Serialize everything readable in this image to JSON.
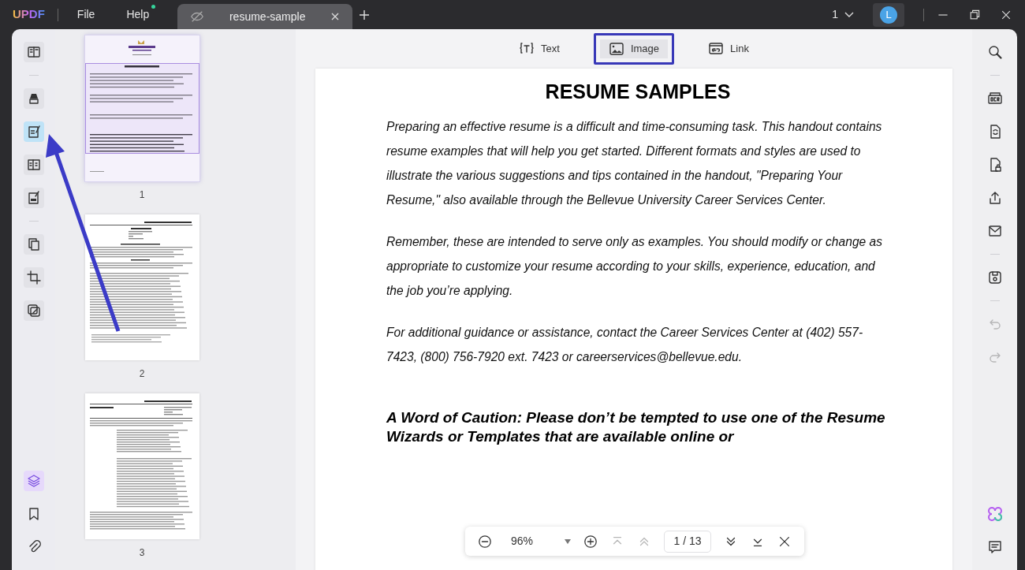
{
  "app": {
    "logo": "UPDF",
    "menus": [
      {
        "label": "File",
        "dot": false
      },
      {
        "label": "Help",
        "dot": true
      }
    ]
  },
  "tabs": [
    {
      "label": "resume-sample",
      "selected": true
    }
  ],
  "page_selector": "1",
  "avatar": "L",
  "left_tools": [
    {
      "kind": "reader",
      "selected": false
    },
    {
      "kind": "divider"
    },
    {
      "kind": "highlighter",
      "selected": false
    },
    {
      "kind": "edit",
      "selected": true
    },
    {
      "kind": "form",
      "selected": false
    },
    {
      "kind": "sign",
      "selected": false
    },
    {
      "kind": "divider"
    },
    {
      "kind": "pages",
      "selected": false
    },
    {
      "kind": "crop",
      "selected": false
    },
    {
      "kind": "watermark",
      "selected": false
    }
  ],
  "left_bottom_tools": [
    {
      "kind": "layers",
      "selected": true
    },
    {
      "kind": "bookmark",
      "selected": false
    },
    {
      "kind": "attachment",
      "selected": false
    }
  ],
  "thumbnails": [
    {
      "number": "1",
      "selected": true,
      "kind": "cover"
    },
    {
      "number": "2",
      "selected": false,
      "kind": "functional"
    },
    {
      "number": "3",
      "selected": false,
      "kind": "chronological"
    }
  ],
  "edit_toolbar": [
    {
      "label": "Text",
      "kind": "text",
      "selected": false
    },
    {
      "label": "Image",
      "kind": "image",
      "selected": true
    },
    {
      "label": "Link",
      "kind": "link",
      "selected": false
    }
  ],
  "document": {
    "heading": "RESUME SAMPLES",
    "paragraphs": [
      "Preparing an effective resume is a difficult and time-consuming task.  This handout contains resume examples that will help you get started.  Different formats and styles are used to illustrate the various suggestions and tips contained in the handout, \"Preparing Your Resume,\" also available through the Bellevue University Career Services Center.",
      "Remember, these are intended to serve only as examples.  You should modify or change as appropriate to customize your resume according to your skills, experience, education, and the job you’re applying.",
      "For additional guidance or assistance, contact the Career Services Center at (402) 557-7423, (800) 756-7920 ext. 7423 or careerservices@bellevue.edu."
    ],
    "caution": "A Word of Caution: Please don’t be tempted to use one of the Resume Wizards or Templates that are available online or"
  },
  "right_tools": [
    {
      "kind": "search",
      "disabled": false
    },
    {
      "kind": "divider"
    },
    {
      "kind": "ocr",
      "disabled": false
    },
    {
      "kind": "convert",
      "disabled": false
    },
    {
      "kind": "protect",
      "disabled": false
    },
    {
      "kind": "share",
      "disabled": false
    },
    {
      "kind": "mail",
      "disabled": false
    },
    {
      "kind": "divider"
    },
    {
      "kind": "save",
      "disabled": false
    },
    {
      "kind": "divider"
    },
    {
      "kind": "undo",
      "disabled": true
    },
    {
      "kind": "redo",
      "disabled": true
    }
  ],
  "right_bottom_tools": [
    {
      "kind": "ai"
    },
    {
      "kind": "comment"
    }
  ],
  "zoom_bar": {
    "zoom": "96%",
    "page": "1 / 13"
  }
}
